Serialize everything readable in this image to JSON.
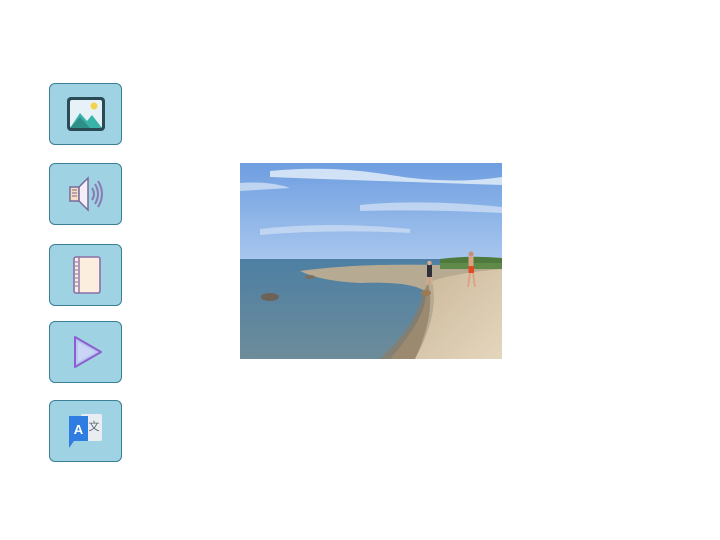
{
  "sidebar": {
    "buttons": [
      {
        "id": "image",
        "icon": "image-icon"
      },
      {
        "id": "audio",
        "icon": "speaker-icon"
      },
      {
        "id": "book",
        "icon": "notebook-icon"
      },
      {
        "id": "play",
        "icon": "play-icon"
      },
      {
        "id": "translate",
        "icon": "translate-icon"
      }
    ],
    "translate_icon_text": {
      "latin": "A",
      "cjk": "文"
    }
  },
  "colors": {
    "button_fill": "#9fd2e2",
    "button_border": "#3a7f95",
    "translate_blue": "#2f7de1"
  },
  "main": {
    "image_subject": "beach-photo"
  }
}
